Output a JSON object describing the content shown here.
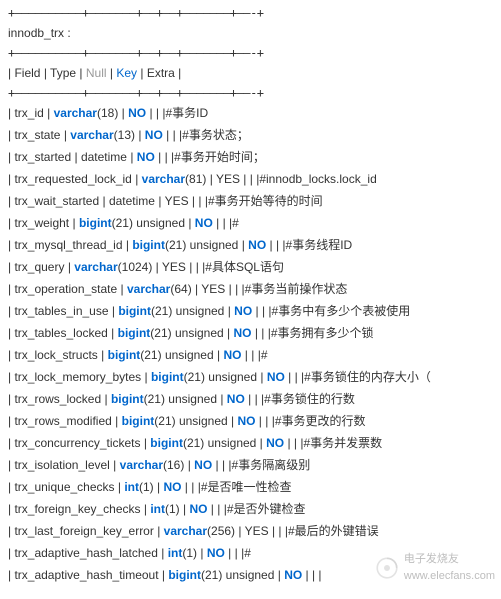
{
  "title": "innodb_trx :",
  "divider": "+——————————+———————+——+—–+———————+——-+",
  "header": {
    "field": "Field",
    "type": "Type",
    "null": "Null",
    "key": "Key",
    "extra": "Extra"
  },
  "rows": [
    {
      "name": "trx_id",
      "type_kw": "varchar",
      "type_args": "(18)",
      "null_val": "NO",
      "null_bold": true,
      "comment": "#事务ID"
    },
    {
      "name": "trx_state",
      "type_kw": "varchar",
      "type_args": "(13)",
      "null_val": "NO",
      "null_bold": true,
      "comment": "#事务状态；"
    },
    {
      "name": "trx_started",
      "type_kw": "",
      "type_args": "datetime",
      "null_val": "NO",
      "null_bold": true,
      "comment": "#事务开始时间；"
    },
    {
      "name": "trx_requested_lock_id",
      "type_kw": "varchar",
      "type_args": "(81)",
      "null_val": "YES",
      "null_bold": false,
      "comment": "#innodb_locks.lock_id"
    },
    {
      "name": "trx_wait_started",
      "type_kw": "",
      "type_args": "datetime",
      "null_val": "YES",
      "null_bold": false,
      "comment": "#事务开始等待的时间"
    },
    {
      "name": "trx_weight",
      "type_kw": "bigint",
      "type_args": "(21) unsigned",
      "null_val": "NO",
      "null_bold": true,
      "comment": "#"
    },
    {
      "name": "trx_mysql_thread_id",
      "type_kw": "bigint",
      "type_args": "(21) unsigned",
      "null_val": "NO",
      "null_bold": true,
      "comment": "#事务线程ID"
    },
    {
      "name": "trx_query",
      "type_kw": "varchar",
      "type_args": "(1024)",
      "null_val": "YES",
      "null_bold": false,
      "comment": "#具体SQL语句"
    },
    {
      "name": "trx_operation_state",
      "type_kw": "varchar",
      "type_args": "(64)",
      "null_val": "YES",
      "null_bold": false,
      "comment": "#事务当前操作状态"
    },
    {
      "name": "trx_tables_in_use",
      "type_kw": "bigint",
      "type_args": "(21) unsigned",
      "null_val": "NO",
      "null_bold": true,
      "comment": "#事务中有多少个表被使用"
    },
    {
      "name": "trx_tables_locked",
      "type_kw": "bigint",
      "type_args": "(21) unsigned",
      "null_val": "NO",
      "null_bold": true,
      "comment": "#事务拥有多少个锁"
    },
    {
      "name": "trx_lock_structs",
      "type_kw": "bigint",
      "type_args": "(21) unsigned",
      "null_val": "NO",
      "null_bold": true,
      "comment": "#"
    },
    {
      "name": "trx_lock_memory_bytes",
      "type_kw": "bigint",
      "type_args": "(21) unsigned",
      "null_val": "NO",
      "null_bold": true,
      "comment": "#事务锁住的内存大小（"
    },
    {
      "name": "trx_rows_locked",
      "type_kw": "bigint",
      "type_args": "(21) unsigned",
      "null_val": "NO",
      "null_bold": true,
      "comment": "#事务锁住的行数"
    },
    {
      "name": "trx_rows_modified",
      "type_kw": "bigint",
      "type_args": "(21) unsigned",
      "null_val": "NO",
      "null_bold": true,
      "comment": "#事务更改的行数"
    },
    {
      "name": "trx_concurrency_tickets",
      "type_kw": "bigint",
      "type_args": "(21) unsigned",
      "null_val": "NO",
      "null_bold": true,
      "comment": "#事务并发票数"
    },
    {
      "name": "trx_isolation_level",
      "type_kw": "varchar",
      "type_args": "(16)",
      "null_val": "NO",
      "null_bold": true,
      "comment": "#事务隔离级别"
    },
    {
      "name": "trx_unique_checks",
      "type_kw": "int",
      "type_args": "(1)",
      "null_val": "NO",
      "null_bold": true,
      "comment": "#是否唯一性检查"
    },
    {
      "name": "trx_foreign_key_checks",
      "type_kw": "int",
      "type_args": "(1)",
      "null_val": "NO",
      "null_bold": true,
      "comment": "#是否外键检查"
    },
    {
      "name": "trx_last_foreign_key_error",
      "type_kw": "varchar",
      "type_args": "(256)",
      "null_val": "YES",
      "null_bold": false,
      "comment": "#最后的外键错误"
    },
    {
      "name": "trx_adaptive_hash_latched",
      "type_kw": "int",
      "type_args": "(1)",
      "null_val": "NO",
      "null_bold": true,
      "comment": "#"
    },
    {
      "name": "trx_adaptive_hash_timeout",
      "type_kw": "bigint",
      "type_args": "(21) unsigned",
      "null_val": "NO",
      "null_bold": true,
      "comment": ""
    }
  ],
  "watermark": {
    "line1": "电子发烧友",
    "line2": "www.elecfans.com"
  }
}
